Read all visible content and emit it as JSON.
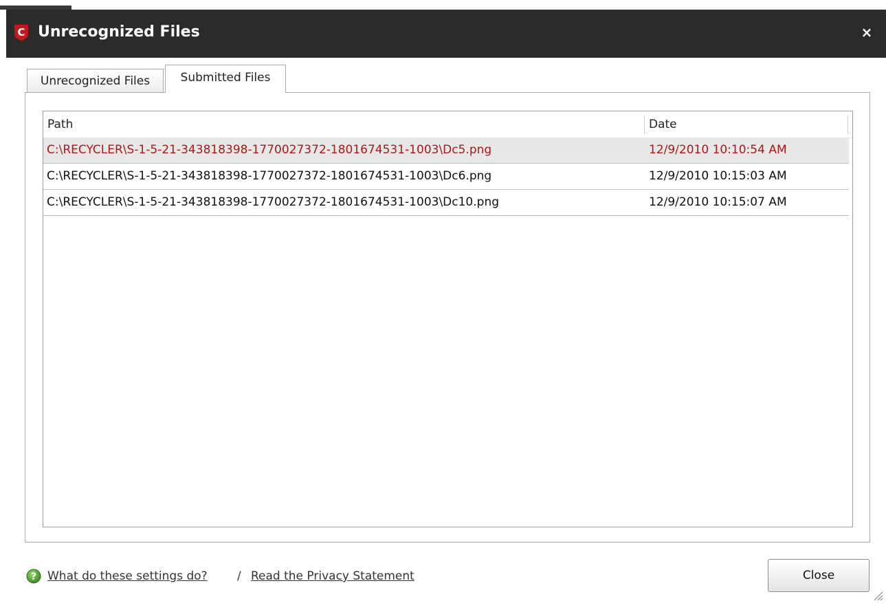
{
  "window": {
    "title": "Unrecognized Files",
    "close_glyph": "×"
  },
  "tabs": [
    {
      "label": "Unrecognized Files",
      "active": false
    },
    {
      "label": "Submitted Files",
      "active": true
    }
  ],
  "table": {
    "columns": [
      "Path",
      "Date"
    ],
    "rows": [
      {
        "path": "C:\\RECYCLER\\S-1-5-21-343818398-1770027372-1801674531-1003\\Dc5.png",
        "date": "12/9/2010 10:10:54 AM",
        "selected": true
      },
      {
        "path": "C:\\RECYCLER\\S-1-5-21-343818398-1770027372-1801674531-1003\\Dc6.png",
        "date": "12/9/2010 10:15:03 AM",
        "selected": false
      },
      {
        "path": "C:\\RECYCLER\\S-1-5-21-343818398-1770027372-1801674531-1003\\Dc10.png",
        "date": "12/9/2010 10:15:07 AM",
        "selected": false
      }
    ]
  },
  "footer": {
    "help_link": "What do these settings do?",
    "separator": "/",
    "privacy_link": "Read the Privacy Statement",
    "close_button": "Close"
  },
  "icons": {
    "app_logo": "comodo-shield-icon",
    "help": "help-question-icon",
    "close": "close-icon",
    "resize": "resize-grip-icon"
  },
  "colors": {
    "titlebar": "#2b2b2b",
    "selected_text": "#b01515",
    "selected_row": "#e8e8e8",
    "logo_red": "#c8161d",
    "help_green": "#5aa83a"
  }
}
